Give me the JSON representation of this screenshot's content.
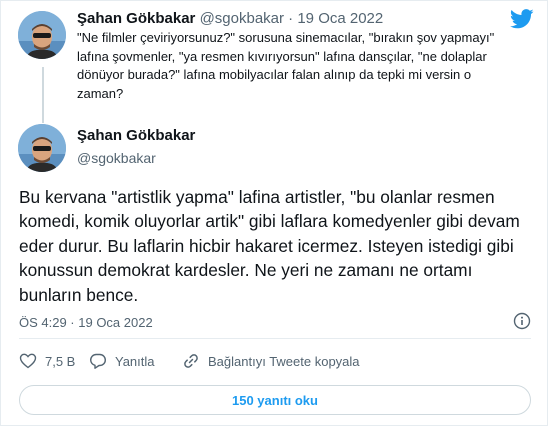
{
  "parent_tweet": {
    "author_name": "Şahan Gökbakar",
    "author_handle": "@sgokbakar",
    "separator": "·",
    "date": "19 Oca 2022",
    "text": "\"Ne filmler çeviriyorsunuz?\" sorusuna sinemacılar, \"bırakın şov yapmayı\" lafına şovmenler, \"ya resmen kıvırıyorsun\" lafına dansçılar, \"ne dolaplar dönüyor burada?\" lafına mobilyacılar falan alınıp da tepki mi versin o zaman?"
  },
  "main_tweet": {
    "author_name": "Şahan Gökbakar",
    "author_handle": "@sgokbakar",
    "text": "Bu kervana \"artistlik yapma\" lafina artistler, \"bu olanlar resmen komedi, komik oluyorlar artik\" gibi laflara komedyenler gibi devam eder durur. Bu laflarin hicbir hakaret icermez. Isteyen istedigi gibi konussun demokrat kardesler. Ne yeri ne zamanı ne ortamı bunların bence.",
    "timestamp": "ÖS 4:29 · 19 Oca 2022"
  },
  "actions": {
    "like_count": "7,5 B",
    "reply_label": "Yanıtla",
    "copy_link_label": "Bağlantıyı Tweete kopyala"
  },
  "replies_button": {
    "label": "150 yanıtı oku"
  },
  "icons": {
    "brand": "twitter-bird-icon",
    "info": "info-icon",
    "like": "heart-icon",
    "reply": "reply-bubble-icon",
    "copy": "link-icon"
  },
  "colors": {
    "brand_blue": "#1d9bf0",
    "text_primary": "#0f1419",
    "text_secondary": "#536471",
    "border": "#cfd9de"
  }
}
